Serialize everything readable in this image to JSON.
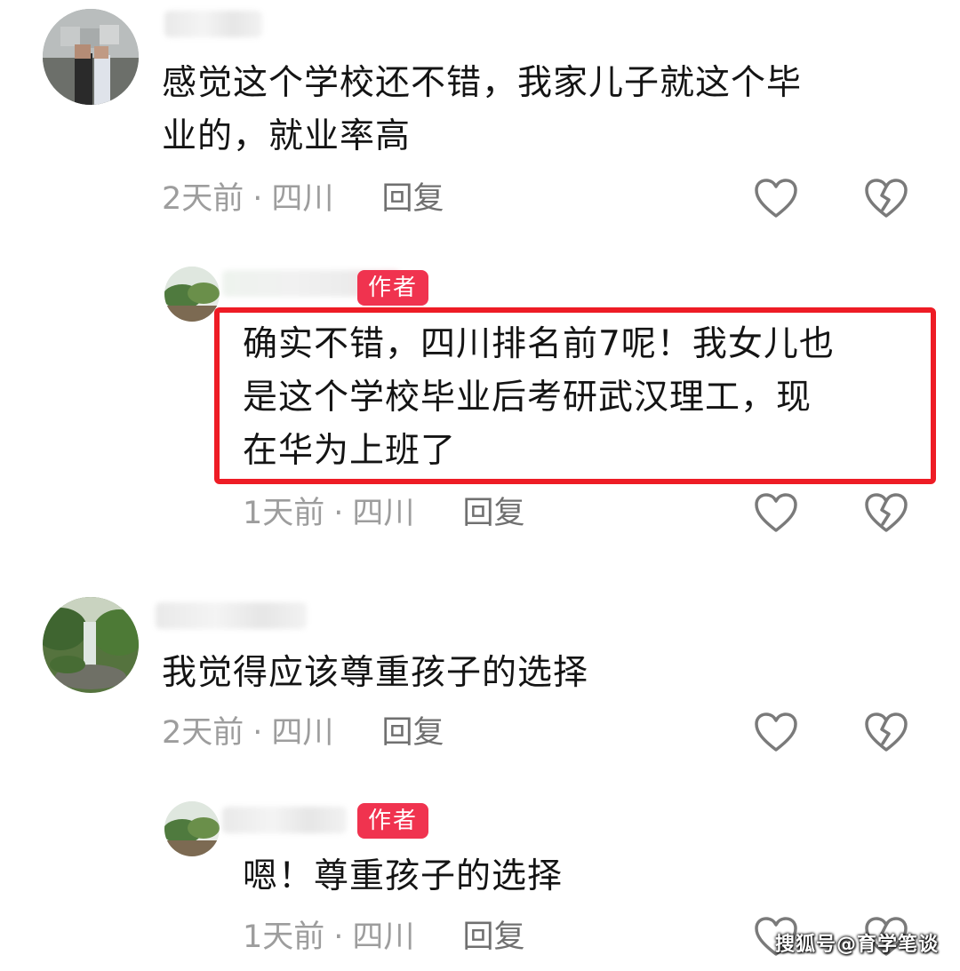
{
  "comments": [
    {
      "text_line1": "感觉这个学校还不错，我家儿子就这个毕",
      "text_line2": "业的，就业率高",
      "time": "2天前",
      "location": "四川",
      "reply": "回复"
    },
    {
      "badge": "作者",
      "text_line1": "确实不错，四川排名前7呢！我女儿也",
      "text_line2": "是这个学校毕业后考研武汉理工，现",
      "text_line3": "在华为上班了",
      "time": "1天前",
      "location": "四川",
      "reply": "回复"
    },
    {
      "text_line1": "我觉得应该尊重孩子的选择",
      "time": "2天前",
      "location": "四川",
      "reply": "回复"
    },
    {
      "badge": "作者",
      "text_line1": "嗯！尊重孩子的选择",
      "time": "1天前",
      "location": "四川",
      "reply": "回复"
    }
  ],
  "separator": "·",
  "watermark": "搜狐号@育学笔谈",
  "colors": {
    "highlight": "#ee1c25",
    "badge": "#f0334f",
    "meta": "#9d9d9d",
    "text": "#141414"
  },
  "icons": [
    "heart-outline-icon",
    "broken-heart-icon"
  ]
}
